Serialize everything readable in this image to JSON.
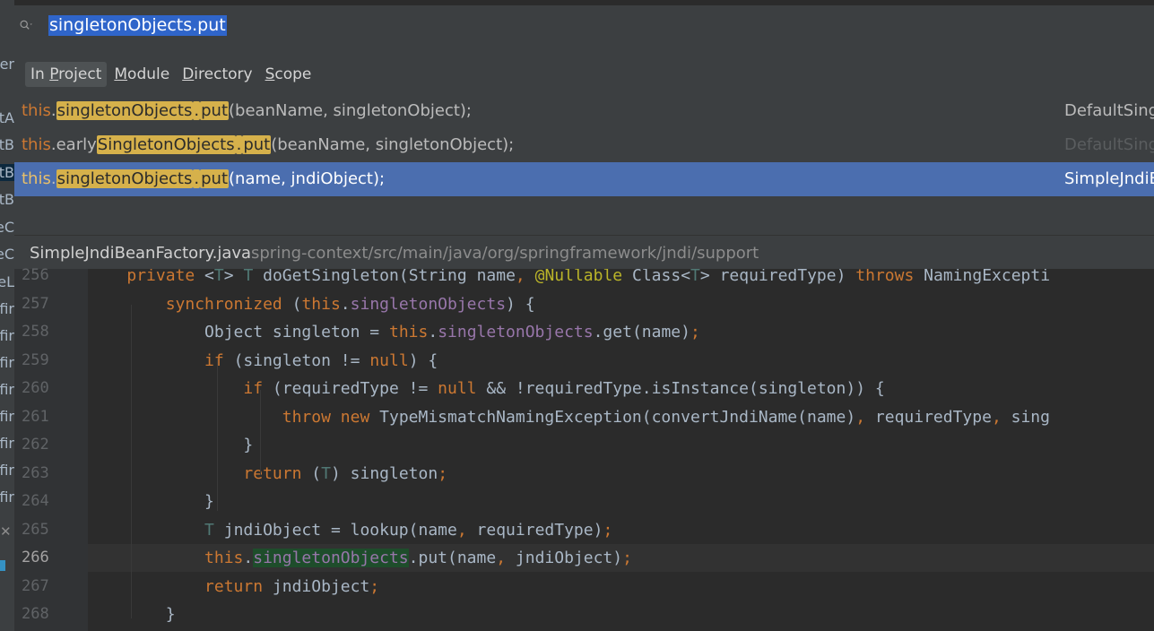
{
  "search": {
    "query": "singletonObjects.put"
  },
  "scopes": [
    {
      "pre": "In ",
      "u": "P",
      "post": "roject",
      "active": true
    },
    {
      "pre": "",
      "u": "M",
      "post": "odule",
      "active": false
    },
    {
      "pre": "",
      "u": "D",
      "post": "irectory",
      "active": false
    },
    {
      "pre": "",
      "u": "S",
      "post": "cope",
      "active": false
    }
  ],
  "results": [
    {
      "this_kw": "this",
      "dot": ".",
      "pre": "",
      "hl": "singletonObjects",
      "dot2": ".",
      "hl2": "put",
      "rest": "(beanName, singletonObject);",
      "file": "DefaultSingletonBeanRegistry.java",
      "selected": false,
      "file_dim": false
    },
    {
      "this_kw": "this",
      "dot": ".",
      "pre": "early",
      "hl": "SingletonObjects",
      "dot2": ".",
      "hl2": "put",
      "rest": "(beanName, singletonObject);",
      "file": "DefaultSingletonBeanRegistry.java",
      "selected": false,
      "file_dim": true
    },
    {
      "this_kw": "this",
      "dot": ".",
      "pre": "",
      "hl": "singletonObjects",
      "dot2": ".",
      "hl2": "put",
      "rest": "(name, jndiObject);",
      "file": "SimpleJndiBeanFactory.java",
      "selected": true,
      "file_dim": false
    }
  ],
  "footer": {
    "filename": "SimpleJndiBeanFactory.java",
    "path": "spring-context/src/main/java/org/springframework/jndi/support"
  },
  "left_strip": [
    "er",
    "tA",
    "tB",
    "tB",
    "tB",
    "eC",
    "eC",
    "eL",
    "fir",
    "fir",
    "fir",
    "fir",
    "fir",
    "fir",
    "fir",
    "fir"
  ],
  "code": {
    "current_line": 266,
    "lines": [
      {
        "n": "256",
        "text": "    private <T> T doGetSingleton(String name, @Nullable Class<T> requiredType) throws NamingExcepti"
      },
      {
        "n": "257",
        "text": "        synchronized (this.singletonObjects) {"
      },
      {
        "n": "258",
        "text": "            Object singleton = this.singletonObjects.get(name);"
      },
      {
        "n": "259",
        "text": "            if (singleton != null) {"
      },
      {
        "n": "260",
        "text": "                if (requiredType != null && !requiredType.isInstance(singleton)) {"
      },
      {
        "n": "261",
        "text": "                    throw new TypeMismatchNamingException(convertJndiName(name), requiredType, sing"
      },
      {
        "n": "262",
        "text": "                }"
      },
      {
        "n": "263",
        "text": "                return (T) singleton;"
      },
      {
        "n": "264",
        "text": "            }"
      },
      {
        "n": "265",
        "text": "            T jndiObject = lookup(name, requiredType);"
      },
      {
        "n": "266",
        "text": "            this.singletonObjects.put(name, jndiObject);"
      },
      {
        "n": "267",
        "text": "            return jndiObject;"
      },
      {
        "n": "268",
        "text": "        }"
      }
    ]
  },
  "colors": {
    "selection": "#4b6eaf",
    "match_highlight": "#d6b14b",
    "keyword": "#cc7832",
    "field": "#9876aa"
  }
}
